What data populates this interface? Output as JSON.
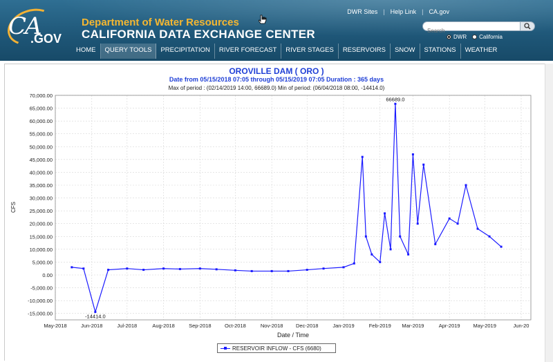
{
  "header": {
    "department": "Department of Water Resources",
    "site_title": "CALIFORNIA DATA EXCHANGE CENTER",
    "logo_text": "CA.GOV",
    "top_links": [
      "DWR Sites",
      "Help Link",
      "CA.gov"
    ],
    "search_placeholder": "Search",
    "radio_options": [
      {
        "label": "DWR",
        "selected": true
      },
      {
        "label": "California",
        "selected": false
      }
    ],
    "nav": [
      "HOME",
      "QUERY TOOLS",
      "PRECIPITATION",
      "RIVER FORECAST",
      "RIVER STAGES",
      "RESERVOIRS",
      "SNOW",
      "STATIONS",
      "WEATHER"
    ],
    "active_nav": "QUERY TOOLS",
    "colors": {
      "header_bg": "#1e5677",
      "dept_text": "#f5b731",
      "nav_text": "#ffffff"
    }
  },
  "chart_header": {
    "title": "OROVILLE DAM ( ORO )",
    "subtitle": "Date from 05/15/2018 07:05 through 05/15/2019 07:05 Duration : 365 days",
    "stats": "Max of period : (02/14/2019 14:00, 66689.0)  Min of period: (06/04/2018 08:00,  -14414.0)"
  },
  "chart_data": {
    "type": "line",
    "title": "OROVILLE DAM ( ORO )",
    "xlabel": "Date / Time",
    "ylabel": "CFS",
    "ylim": [
      -17500,
      70000
    ],
    "y_ticks": [
      -15000,
      -10000,
      -5000,
      0,
      5000,
      10000,
      15000,
      20000,
      25000,
      30000,
      35000,
      40000,
      45000,
      50000,
      55000,
      60000,
      65000,
      70000
    ],
    "y_tick_labels": [
      "-15,000.00",
      "-10,000.00",
      "-5,000.00",
      "0.00",
      "5,000.00",
      "10,000.00",
      "15,000.00",
      "20,000.00",
      "25,000.00",
      "30,000.00",
      "35,000.00",
      "40,000.00",
      "45,000.00",
      "50,000.00",
      "55,000.00",
      "60,000.00",
      "65,000.00",
      "70,000.00"
    ],
    "x_tick_labels": [
      "May-2018",
      "Jun-2018",
      "Jul-2018",
      "Aug-2018",
      "Sep-2018",
      "Oct-2018",
      "Nov-2018",
      "Dec-2018",
      "Jan-2019",
      "Feb-2019",
      "Mar-2019",
      "Apr-2019",
      "May-2019",
      "Jun-20"
    ],
    "grid": true,
    "legend_position": "bottom-center",
    "series": [
      {
        "name": "RESERVOIR INFLOW - CFS (6680)",
        "color": "#1a1aff",
        "x": [
          "2018-05-15",
          "2018-05-25",
          "2018-06-04",
          "2018-06-15",
          "2018-07-01",
          "2018-07-15",
          "2018-08-01",
          "2018-08-15",
          "2018-09-01",
          "2018-09-15",
          "2018-10-01",
          "2018-10-15",
          "2018-11-01",
          "2018-11-15",
          "2018-12-01",
          "2018-12-15",
          "2019-01-01",
          "2019-01-10",
          "2019-01-17",
          "2019-01-20",
          "2019-01-25",
          "2019-02-01",
          "2019-02-05",
          "2019-02-10",
          "2019-02-14",
          "2019-02-18",
          "2019-02-25",
          "2019-03-01",
          "2019-03-05",
          "2019-03-10",
          "2019-03-20",
          "2019-04-01",
          "2019-04-08",
          "2019-04-15",
          "2019-04-25",
          "2019-05-05",
          "2019-05-15"
        ],
        "y": [
          3000,
          2500,
          -14414,
          2000,
          2500,
          2000,
          2500,
          2300,
          2500,
          2200,
          1800,
          1500,
          1500,
          1500,
          2000,
          2500,
          3000,
          4500,
          46000,
          15000,
          8000,
          5000,
          24000,
          10000,
          66689,
          15000,
          8000,
          47000,
          20000,
          43000,
          12000,
          22000,
          20000,
          35000,
          18000,
          15000,
          11000
        ]
      }
    ],
    "annotations": [
      {
        "text": "66689.0",
        "x": "2019-02-14",
        "y": 66689
      },
      {
        "text": "-14414.0",
        "x": "2018-06-04",
        "y": -14414
      }
    ]
  },
  "legend": {
    "label": "RESERVOIR INFLOW - CFS (6680)"
  }
}
